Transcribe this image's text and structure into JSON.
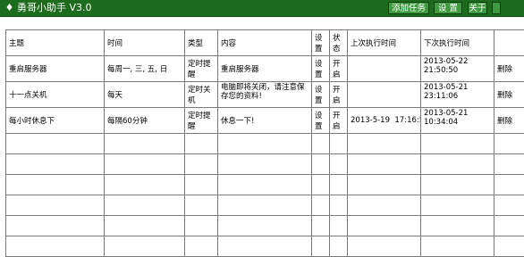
{
  "window": {
    "title": "勇哥小助手 V3.0",
    "icon": "app-icon"
  },
  "toolbar": {
    "add_task_label": "添加任务",
    "settings_label": "设 置",
    "about_label": "关于",
    "extra_label": ""
  },
  "table": {
    "columns": [
      "主题",
      "时间",
      "类型",
      "内容",
      "设置",
      "状态",
      "上次执行时间",
      "下次执行时间",
      ""
    ],
    "rows": [
      {
        "subject": "重启服务器",
        "time": "每周一, 三, 五, 日",
        "type": "定时提醒",
        "content": "重启服务器",
        "settings": "设置",
        "status": "开启",
        "last_run": "",
        "next_run_date": "2013-05-22",
        "next_run_time": "21:50:50",
        "delete": "删除"
      },
      {
        "subject": "十一点关机",
        "time": "每天",
        "type": "定时关机",
        "content": "电脑即将关闭，请注意保存您的资料!",
        "settings": "设置",
        "status": "开启",
        "last_run": "",
        "next_run_date": "2013-05-21",
        "next_run_time": "23:11:06",
        "delete": "删除"
      },
      {
        "subject": "每小时休息下",
        "time": "每隔60分钟",
        "type": "定时提醒",
        "content": "休息一下!",
        "settings": "设置",
        "status": "开启",
        "last_run": "2013-5-19  17:16:51",
        "next_run_date": "2013-05-21",
        "next_run_time": "10:34:04",
        "delete": "删除"
      }
    ]
  },
  "colors": {
    "titlebar": "#1d6b1d",
    "button": "#3f9a3f",
    "grid_line": "#7a7a7a"
  }
}
